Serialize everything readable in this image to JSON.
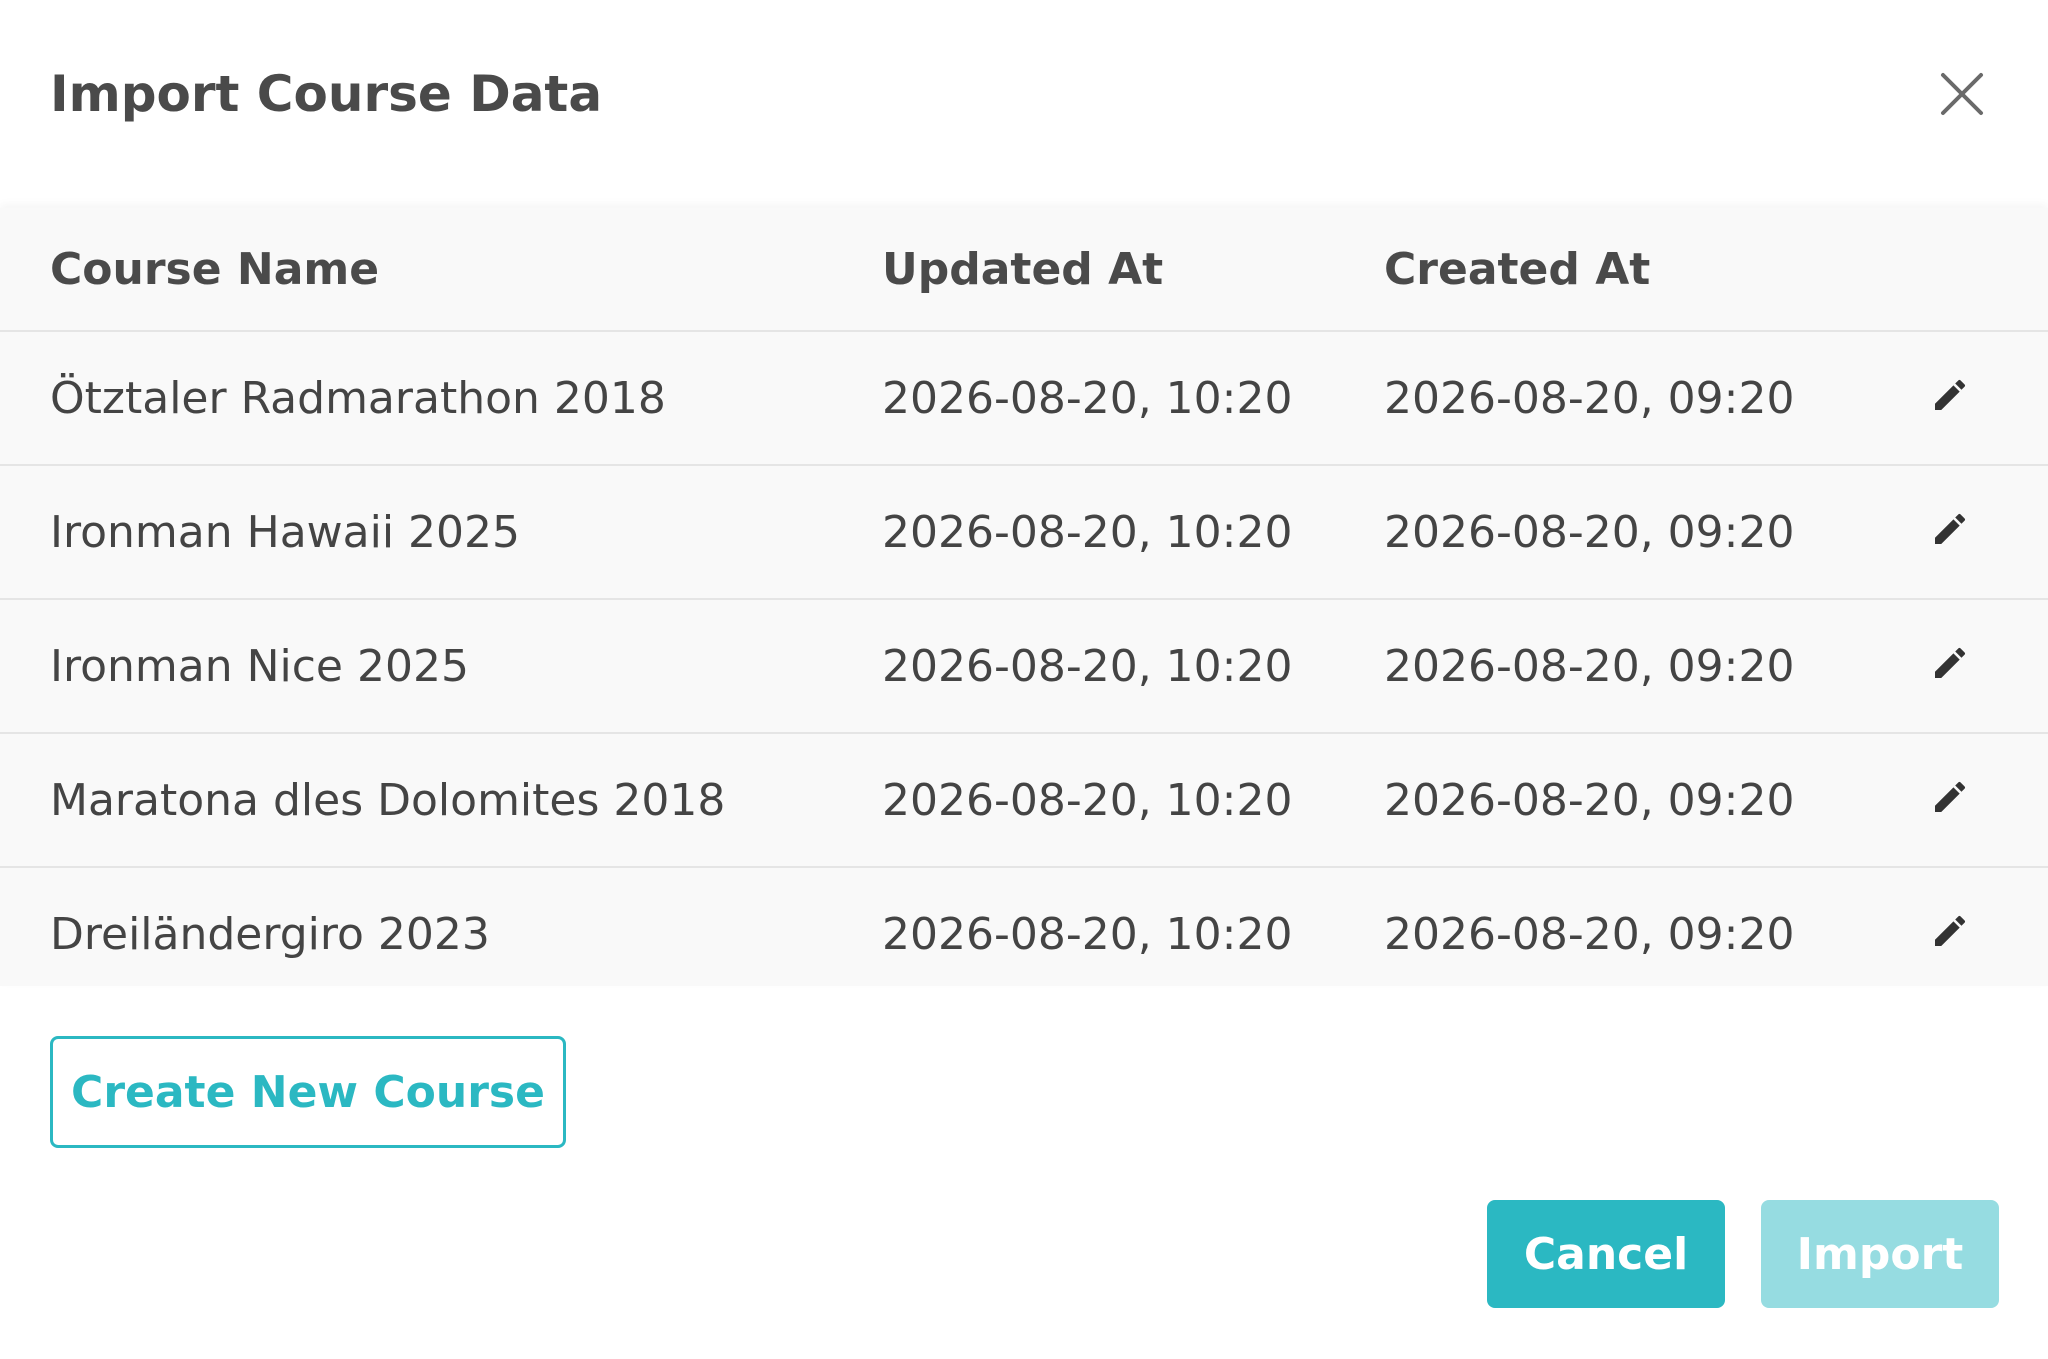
{
  "dialog": {
    "title": "Import Course Data"
  },
  "table": {
    "headers": {
      "name": "Course Name",
      "updated": "Updated At",
      "created": "Created At"
    },
    "rows": [
      {
        "name": "Ötztaler Radmarathon 2018",
        "updated": "2026-08-20, 10:20",
        "created": "2026-08-20, 09:20"
      },
      {
        "name": "Ironman Hawaii 2025",
        "updated": "2026-08-20, 10:20",
        "created": "2026-08-20, 09:20"
      },
      {
        "name": "Ironman Nice 2025",
        "updated": "2026-08-20, 10:20",
        "created": "2026-08-20, 09:20"
      },
      {
        "name": "Maratona dles Dolomites 2018",
        "updated": "2026-08-20, 10:20",
        "created": "2026-08-20, 09:20"
      },
      {
        "name": "Dreiländergiro 2023",
        "updated": "2026-08-20, 10:20",
        "created": "2026-08-20, 09:20"
      }
    ],
    "row_action_icon": "pencil-icon"
  },
  "actions": {
    "create_label": "Create New Course",
    "cancel_label": "Cancel",
    "import_label": "Import",
    "import_disabled": true
  },
  "icons": {
    "close": "close-icon",
    "edit": "pencil-icon"
  },
  "colors": {
    "accent": "#2bb8c2",
    "accent_disabled": "#96dce1",
    "text": "#444444",
    "table_bg": "#f9f9f9",
    "divider": "#e5e5e5"
  }
}
